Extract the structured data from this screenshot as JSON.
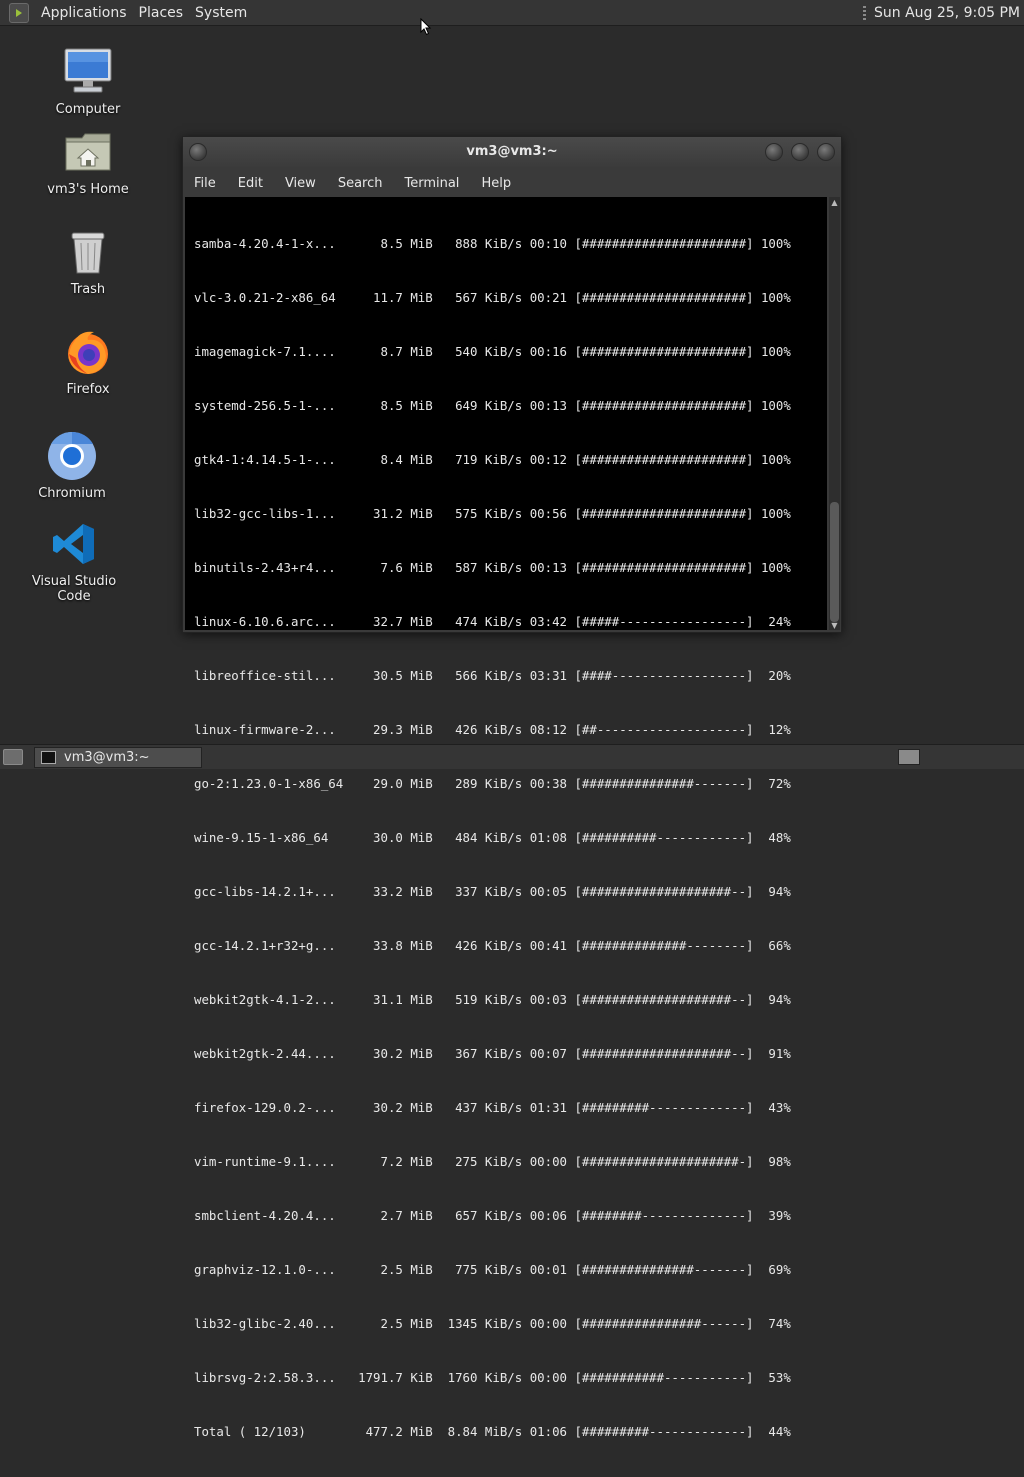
{
  "top_panel": {
    "menus": [
      "Applications",
      "Places",
      "System"
    ],
    "clock": "Sun Aug 25, 9:05 PM"
  },
  "desktop_icons": [
    {
      "label": "Computer",
      "icon": "computer-icon"
    },
    {
      "label": "vm3's Home",
      "icon": "home-folder-icon"
    },
    {
      "label": "Trash",
      "icon": "trash-icon"
    },
    {
      "label": "Firefox",
      "icon": "firefox-icon"
    },
    {
      "label": "Chromium",
      "icon": "chromium-icon"
    },
    {
      "label": "Visual Studio Code",
      "icon": "vscode-icon"
    }
  ],
  "terminal": {
    "title": "vm3@vm3:~",
    "menu": [
      "File",
      "Edit",
      "View",
      "Search",
      "Terminal",
      "Help"
    ],
    "lines": [
      "samba-4.20.4-1-x...      8.5 MiB   888 KiB/s 00:10 [######################] 100%",
      "vlc-3.0.21-2-x86_64     11.7 MiB   567 KiB/s 00:21 [######################] 100%",
      "imagemagick-7.1....      8.7 MiB   540 KiB/s 00:16 [######################] 100%",
      "systemd-256.5-1-...      8.5 MiB   649 KiB/s 00:13 [######################] 100%",
      "gtk4-1:4.14.5-1-...      8.4 MiB   719 KiB/s 00:12 [######################] 100%",
      "lib32-gcc-libs-1...     31.2 MiB   575 KiB/s 00:56 [######################] 100%",
      "binutils-2.43+r4...      7.6 MiB   587 KiB/s 00:13 [######################] 100%",
      "linux-6.10.6.arc...     32.7 MiB   474 KiB/s 03:42 [#####-----------------]  24%",
      "libreoffice-stil...     30.5 MiB   566 KiB/s 03:31 [####------------------]  20%",
      "linux-firmware-2...     29.3 MiB   426 KiB/s 08:12 [##--------------------]  12%",
      "go-2:1.23.0-1-x86_64    29.0 MiB   289 KiB/s 00:38 [###############-------]  72%",
      "wine-9.15-1-x86_64      30.0 MiB   484 KiB/s 01:08 [##########------------]  48%",
      "gcc-libs-14.2.1+...     33.2 MiB   337 KiB/s 00:05 [####################--]  94%",
      "gcc-14.2.1+r32+g...     33.8 MiB   426 KiB/s 00:41 [##############--------]  66%",
      "webkit2gtk-4.1-2...     31.1 MiB   519 KiB/s 00:03 [####################--]  94%",
      "webkit2gtk-2.44....     30.2 MiB   367 KiB/s 00:07 [####################--]  91%",
      "firefox-129.0.2-...     30.2 MiB   437 KiB/s 01:31 [#########-------------]  43%",
      "vim-runtime-9.1....      7.2 MiB   275 KiB/s 00:00 [#####################-]  98%",
      "smbclient-4.20.4...      2.7 MiB   657 KiB/s 00:06 [########--------------]  39%",
      "graphviz-12.1.0-...      2.5 MiB   775 KiB/s 00:01 [###############-------]  69%",
      "lib32-glibc-2.40...      2.5 MiB  1345 KiB/s 00:00 [################------]  74%",
      "librsvg-2:2.58.3...   1791.7 KiB  1760 KiB/s 00:00 [###########-----------]  53%",
      "Total ( 12/103)        477.2 MiB  8.84 MiB/s 01:06 [#########-------------]  44%"
    ]
  },
  "taskbar": {
    "task_label": "vm3@vm3:~"
  }
}
